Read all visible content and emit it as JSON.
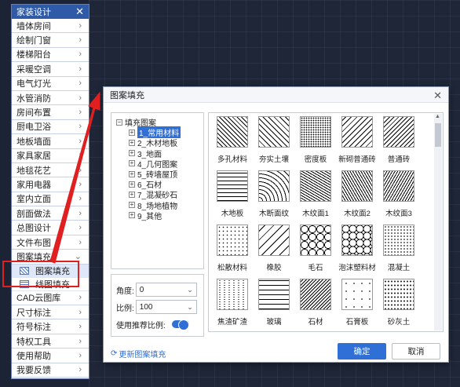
{
  "sidebar": {
    "title": "家装设计",
    "items_top": [
      "墙体房间",
      "绘制门窗",
      "楼梯阳台",
      "采暖空调",
      "电气灯光",
      "水管消防",
      "房间布置",
      "厨电卫浴",
      "地板墙面",
      "家具家居",
      "地毯花艺",
      "家用电器",
      "室内立面",
      "剖面做法",
      "总图设计",
      "文件布图"
    ],
    "open_item": "图案填充",
    "sub_items": [
      "图案填充",
      "线图填充"
    ],
    "items_bottom": [
      "CAD云图库",
      "尺寸标注",
      "符号标注",
      "特权工具",
      "使用帮助",
      "我要反馈"
    ]
  },
  "dialog": {
    "title": "图案填充",
    "tree_root": "填充图案",
    "tree_items": [
      "1_常用材料",
      "2_木材地板",
      "3_地面",
      "4_几何图案",
      "5_砖墙屋顶",
      "6_石材",
      "7_混凝砂石",
      "8_场地植物",
      "9_其他"
    ],
    "angle_label": "角度:",
    "angle_value": "0",
    "scale_label": "比例:",
    "scale_value": "100",
    "recommend_label": "使用推荐比例:",
    "recommend_on": true,
    "update_link": "更新图案填充",
    "ok_label": "确定",
    "cancel_label": "取消",
    "patterns": [
      "多孔材料",
      "夯实土壤",
      "密度板",
      "新砌普通砖",
      "普通砖",
      "木地板",
      "木断面纹",
      "木纹面1",
      "木纹面2",
      "木纹面3",
      "松散材料",
      "橡胶",
      "毛石",
      "泡沫塑料材",
      "混凝土",
      "焦渣矿渣",
      "玻璃",
      "石材",
      "石膏板",
      "砂灰土"
    ]
  },
  "colors": {
    "accent": "#2f6fd6",
    "header": "#2f5aa8",
    "highlight": "#e02020"
  }
}
